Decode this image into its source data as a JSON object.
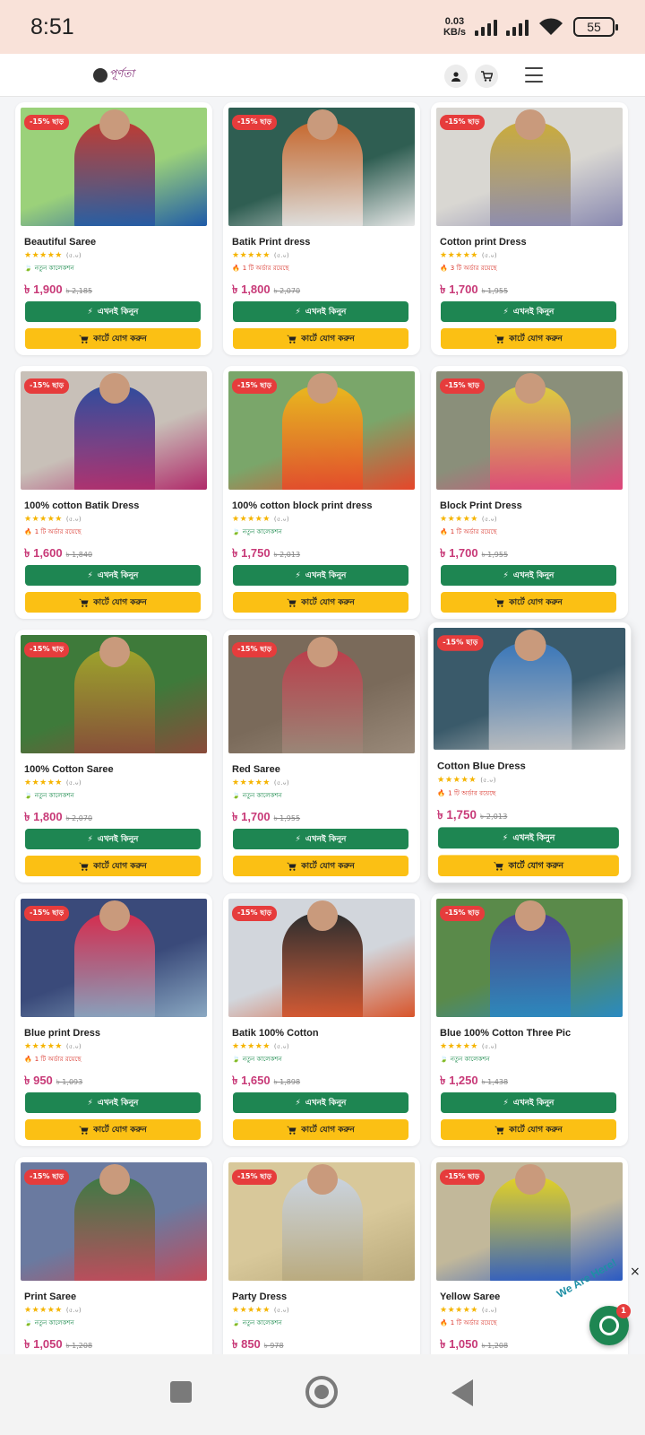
{
  "status_bar": {
    "time": "8:51",
    "speed_value": "0.03",
    "speed_unit": "KB/s",
    "battery": "55"
  },
  "header": {
    "logo_text": "পূর্ণতা",
    "icons": [
      "user-icon",
      "cart-icon",
      "menu-icon"
    ]
  },
  "labels": {
    "buy_now": "এখনই কিনুন",
    "add_to_cart": "কার্টে যোগ করুন",
    "rating_value": "(৫.০)",
    "stars": "★★★★★"
  },
  "products": [
    {
      "name": "Beautiful Saree",
      "badge": "-15% ছাড়",
      "tag": "নতুন কালেকশন",
      "tag_type": "green",
      "price": "৳ 1,900",
      "old_price": "৳ 2,185",
      "colors": [
        "#9bd17a",
        "#c22b2b",
        "#1e5aa8"
      ]
    },
    {
      "name": "Batik Print dress",
      "badge": "-15% ছাড়",
      "tag": "1 টি অর্ডার রয়েছে",
      "tag_type": "red",
      "price": "৳ 1,800",
      "old_price": "৳ 2,070",
      "colors": [
        "#2f5e52",
        "#d86a2b",
        "#e8e8e8"
      ]
    },
    {
      "name": "Cotton print Dress",
      "badge": "-15% ছাড়",
      "tag": "3 টি অর্ডার রয়েছে",
      "tag_type": "red",
      "price": "৳ 1,700",
      "old_price": "৳ 1,955",
      "colors": [
        "#d9d7d2",
        "#c9a72a",
        "#8888b0"
      ]
    },
    {
      "name": "100% cotton Batik Dress",
      "badge": "-15% ছাড়",
      "tag": "1 টি অর্ডার রয়েছে",
      "tag_type": "red",
      "price": "৳ 1,600",
      "old_price": "৳ 1,840",
      "colors": [
        "#c8c0b8",
        "#1f3f9a",
        "#b02a6a"
      ]
    },
    {
      "name": "100% cotton block print dress",
      "badge": "-15% ছাড়",
      "tag": "নতুন কালেকশন",
      "tag_type": "green",
      "price": "৳ 1,750",
      "old_price": "৳ 2,013",
      "colors": [
        "#7aa66a",
        "#f5b916",
        "#e6462a"
      ]
    },
    {
      "name": "Block Print Dress",
      "badge": "-15% ছাড়",
      "tag": "1 টি অর্ডার রয়েছে",
      "tag_type": "red",
      "price": "৳ 1,700",
      "old_price": "৳ 1,955",
      "colors": [
        "#8a8f7a",
        "#e6d43a",
        "#e0457a"
      ]
    },
    {
      "name": "100% Cotton Saree",
      "badge": "-15% ছাড়",
      "tag": "নতুন কালেকশন",
      "tag_type": "green",
      "price": "৳ 1,800",
      "old_price": "৳ 2,070",
      "colors": [
        "#3e7a3a",
        "#a8a82a",
        "#8a4a3a"
      ]
    },
    {
      "name": "Red Saree",
      "badge": "-15% ছাড়",
      "tag": "নতুন কালেকশন",
      "tag_type": "green",
      "price": "৳ 1,700",
      "old_price": "৳ 1,955",
      "colors": [
        "#7a6a5a",
        "#c23a4a",
        "#9a8a7a"
      ]
    },
    {
      "name": "Cotton Blue Dress",
      "badge": "-15% ছাড়",
      "tag": "1 টি অর্ডার রয়েছে",
      "tag_type": "red",
      "price": "৳ 1,750",
      "old_price": "৳ 2,013",
      "colors": [
        "#3a5a6a",
        "#3a7ac2",
        "#c2c2c2"
      ]
    },
    {
      "name": "Blue print Dress",
      "badge": "-15% ছাড়",
      "tag": "1 টি অর্ডার রয়েছে",
      "tag_type": "red",
      "price": "৳ 950",
      "old_price": "৳ 1,093",
      "colors": [
        "#3a4a7a",
        "#e62a4a",
        "#8aa8c2"
      ]
    },
    {
      "name": "Batik 100% Cotton",
      "badge": "-15% ছাড়",
      "tag": "নতুন কালেকশন",
      "tag_type": "green",
      "price": "৳ 1,650",
      "old_price": "৳ 1,898",
      "colors": [
        "#d2d6dc",
        "#1a1a1a",
        "#d8542a"
      ]
    },
    {
      "name": "Blue 100% Cotton Three Pic",
      "badge": "-15% ছাড়",
      "tag": "নতুন কালেকশন",
      "tag_type": "green",
      "price": "৳ 1,250",
      "old_price": "৳ 1,438",
      "colors": [
        "#5a8a4a",
        "#4a3a9a",
        "#2a8ac2"
      ]
    },
    {
      "name": "Print Saree",
      "badge": "-15% ছাড়",
      "tag": "নতুন কালেকশন",
      "tag_type": "green",
      "price": "৳ 1,050",
      "old_price": "৳ 1,208",
      "colors": [
        "#6a7aa0",
        "#3a7a3a",
        "#c24a5a"
      ]
    },
    {
      "name": "Party Dress",
      "badge": "-15% ছাড়",
      "tag": "নতুন কালেকশন",
      "tag_type": "green",
      "price": "৳ 850",
      "old_price": "৳ 978",
      "colors": [
        "#d8c89a",
        "#c8d4e6",
        "#b8a87a"
      ]
    },
    {
      "name": "Yellow Saree",
      "badge": "-15% ছাড়",
      "tag": "1 টি অর্ডার রয়েছে",
      "tag_type": "red",
      "price": "৳ 1,050",
      "old_price": "৳ 1,208",
      "colors": [
        "#c2b89a",
        "#e6d41a",
        "#2a5ac2"
      ]
    }
  ],
  "chat_widget": {
    "label": "We Are Here!",
    "count": "1",
    "close": "×"
  }
}
